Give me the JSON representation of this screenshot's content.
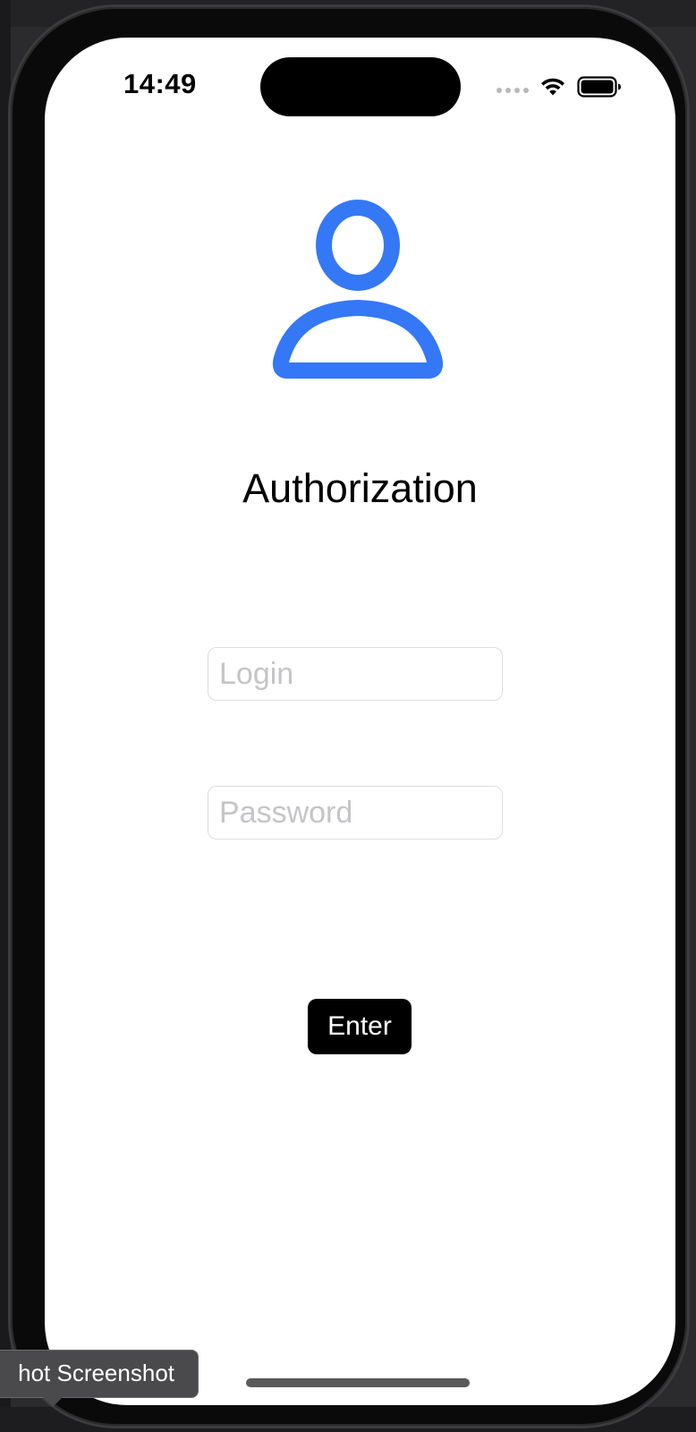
{
  "status_bar": {
    "time": "14:49"
  },
  "icons": {
    "avatar": "person-icon",
    "wifi": "wifi-icon",
    "battery": "battery-icon",
    "signal": "signal-dots-icon"
  },
  "colors": {
    "accent": "#3478f6",
    "button_bg": "#000000",
    "button_text": "#ffffff",
    "placeholder": "#c5c5c8"
  },
  "auth": {
    "title": "Authorization",
    "login_placeholder": "Login",
    "login_value": "",
    "password_placeholder": "Password",
    "password_value": "",
    "enter_label": "Enter"
  },
  "tooltip": {
    "text": "hot Screenshot"
  }
}
